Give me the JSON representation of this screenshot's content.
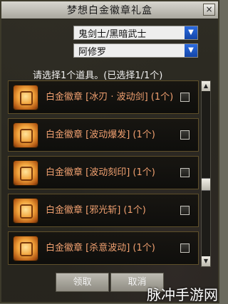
{
  "window": {
    "title": "梦想白金徽章礼盒",
    "close_label": "×"
  },
  "selects": [
    {
      "value": "鬼剑士/黑暗武士"
    },
    {
      "value": "阿修罗"
    }
  ],
  "hint": "请选择1个道具。(已选择1/1个)",
  "items": [
    {
      "name": "白金徽章 [冰刃 · 波动剑] (1个)"
    },
    {
      "name": "白金徽章 [波动爆发] (1个)"
    },
    {
      "name": "白金徽章 [波动刻印] (1个)"
    },
    {
      "name": "白金徽章 [邪光斩] (1个)"
    },
    {
      "name": "白金徽章 [杀意波动] (1个)"
    }
  ],
  "buttons": {
    "confirm": "领取",
    "cancel": "取消"
  },
  "watermark": "脉冲手游网"
}
